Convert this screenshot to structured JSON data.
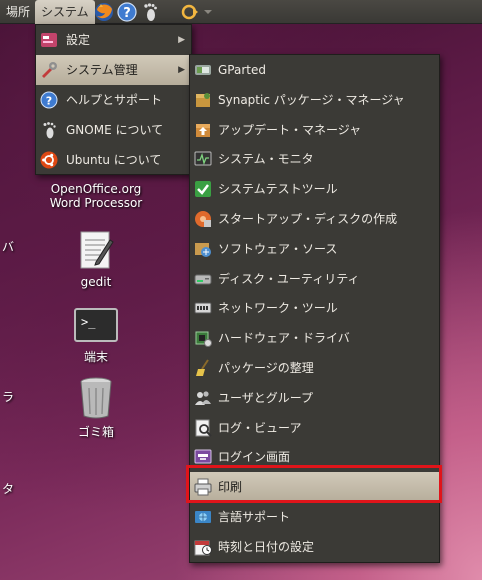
{
  "panel": {
    "places": "場所",
    "system": "システム"
  },
  "desktop": {
    "openoffice_line1": "OpenOffice.org",
    "openoffice_line2": "Word Processor",
    "gedit": "gedit",
    "terminal": "端末",
    "trash": "ゴミ箱",
    "edge_chars": [
      "バ",
      "ラ",
      "タ"
    ]
  },
  "system_menu": {
    "items": [
      {
        "label": "設定",
        "icon": "preferences-icon",
        "has_submenu": true
      },
      {
        "label": "システム管理",
        "icon": "administration-icon",
        "has_submenu": true
      },
      {
        "label": "ヘルプとサポート",
        "icon": "help-icon",
        "has_submenu": false
      },
      {
        "label": "GNOME について",
        "icon": "gnome-foot-icon",
        "has_submenu": false
      },
      {
        "label": "Ubuntu について",
        "icon": "ubuntu-logo-icon",
        "has_submenu": false
      }
    ],
    "arrow": "▶"
  },
  "admin_menu": {
    "items": [
      {
        "label": "GParted",
        "icon": "gparted-icon"
      },
      {
        "label": "Synaptic パッケージ・マネージャ",
        "icon": "synaptic-icon"
      },
      {
        "label": "アップデート・マネージャ",
        "icon": "update-manager-icon"
      },
      {
        "label": "システム・モニタ",
        "icon": "system-monitor-icon"
      },
      {
        "label": "システムテストツール",
        "icon": "system-test-icon"
      },
      {
        "label": "スタートアップ・ディスクの作成",
        "icon": "startup-disk-icon"
      },
      {
        "label": "ソフトウェア・ソース",
        "icon": "software-sources-icon"
      },
      {
        "label": "ディスク・ユーティリティ",
        "icon": "disk-utility-icon"
      },
      {
        "label": "ネットワーク・ツール",
        "icon": "network-tools-icon"
      },
      {
        "label": "ハードウェア・ドライバ",
        "icon": "hardware-drivers-icon"
      },
      {
        "label": "パッケージの整理",
        "icon": "broom-icon"
      },
      {
        "label": "ユーザとグループ",
        "icon": "users-groups-icon"
      },
      {
        "label": "ログ・ビューア",
        "icon": "log-viewer-icon"
      },
      {
        "label": "ログイン画面",
        "icon": "login-screen-icon"
      },
      {
        "label": "印刷",
        "icon": "printer-icon",
        "highlighted": true
      },
      {
        "label": "言語サポート",
        "icon": "language-support-icon"
      },
      {
        "label": "時刻と日付の設定",
        "icon": "time-date-icon"
      }
    ]
  },
  "colors": {
    "menu_bg": "#3b3a36",
    "highlight": "#c6bead",
    "selection_frame": "#e0141a"
  }
}
